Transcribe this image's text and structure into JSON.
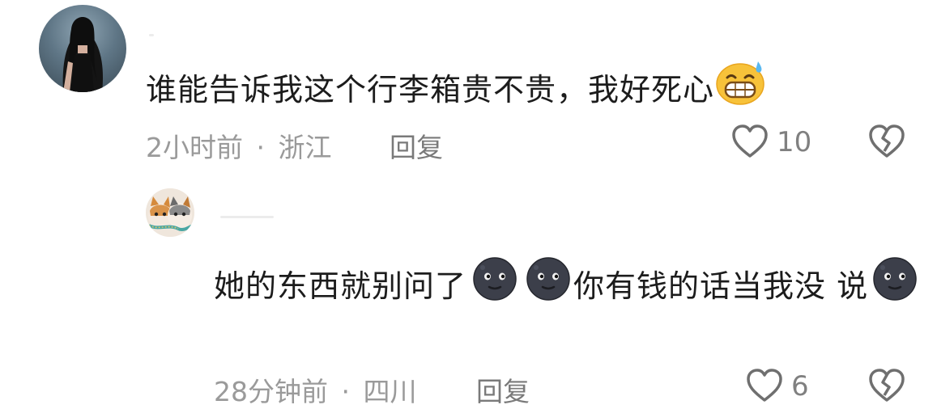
{
  "comments": [
    {
      "text": "谁能告诉我这个行李箱贵不贵，我好死心",
      "emoji": "grimacing-sweat-emoji",
      "time": "2小时前",
      "separator": "·",
      "location": "浙江",
      "reply_label": "回复",
      "likes": "10"
    },
    {
      "text_part1": "她的东西就别问了",
      "text_part2": "你有钱的话当我没",
      "text_part3": "说",
      "emoji": "new-moon-face-emoji",
      "time": "28分钟前",
      "separator": "·",
      "location": "四川",
      "reply_label": "回复",
      "likes": "6"
    }
  ],
  "icons": {
    "like": "heart-outline-icon",
    "dislike": "broken-heart-icon"
  },
  "colors": {
    "text": "#1c1c1c",
    "meta": "#9a9a9a",
    "icon": "#777777"
  }
}
